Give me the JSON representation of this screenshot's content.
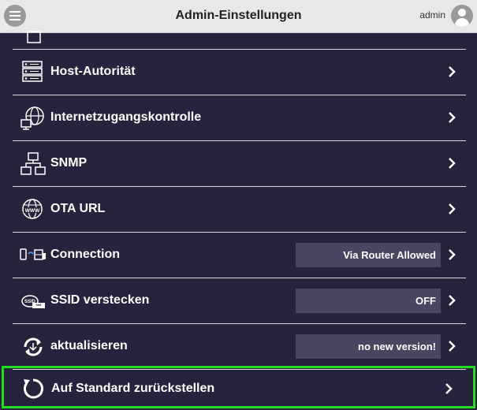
{
  "header": {
    "title": "Admin-Einstellungen",
    "user": "admin",
    "menu_icon": "hamburger-menu-icon",
    "avatar_icon": "user-avatar-icon"
  },
  "rows": [
    {
      "label": "Host-Autorität",
      "icon": "server-list-icon"
    },
    {
      "label": "Internetzugangskontrolle",
      "icon": "globe-monitor-icon"
    },
    {
      "label": "SNMP",
      "icon": "network-topology-icon"
    },
    {
      "label": "OTA URL",
      "icon": "www-globe-icon"
    },
    {
      "label": "Connection",
      "value": "Via Router Allowed",
      "icon": "device-connection-icon"
    },
    {
      "label": "SSID verstecken",
      "value": "OFF",
      "icon": "ssid-hide-icon"
    },
    {
      "label": "aktualisieren",
      "value": "no new version!",
      "icon": "update-arrows-icon"
    },
    {
      "label": "Auf Standard zurückstellen",
      "icon": "reset-arrow-icon"
    }
  ],
  "colors": {
    "background": "#27233c",
    "header": "#e8e8e8",
    "value_box": "#4a4560",
    "highlight": "#22dd22"
  }
}
